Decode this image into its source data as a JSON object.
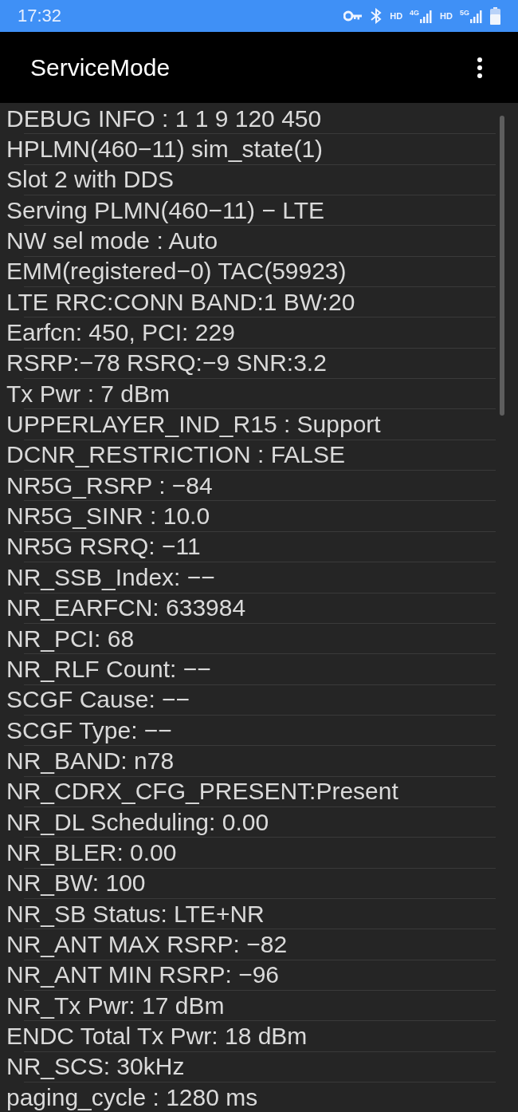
{
  "status_bar": {
    "time": "17:32",
    "indicators": [
      {
        "kind": "key"
      },
      {
        "kind": "bluetooth"
      },
      {
        "kind": "hd",
        "label": "HD"
      },
      {
        "kind": "signal",
        "label": "4G"
      },
      {
        "kind": "hd",
        "label": "HD"
      },
      {
        "kind": "signal",
        "label": "5G"
      },
      {
        "kind": "battery"
      }
    ]
  },
  "app_bar": {
    "title": "ServiceMode"
  },
  "rows": [
    "DEBUG INFO : 1 1 9 120 450",
    "HPLMN(460−11) sim_state(1)",
    "Slot 2 with DDS",
    "Serving PLMN(460−11) − LTE",
    "NW sel mode : Auto",
    "EMM(registered−0) TAC(59923)",
    "LTE RRC:CONN BAND:1 BW:20",
    "Earfcn: 450, PCI: 229",
    "RSRP:−78 RSRQ:−9 SNR:3.2",
    "Tx Pwr : 7 dBm",
    "UPPERLAYER_IND_R15 : Support",
    "DCNR_RESTRICTION : FALSE",
    "NR5G_RSRP : −84",
    "NR5G_SINR : 10.0",
    "NR5G RSRQ: −11",
    "NR_SSB_Index: −−",
    "NR_EARFCN: 633984",
    "NR_PCI: 68",
    "NR_RLF Count: −−",
    "SCGF Cause: −−",
    "SCGF Type: −−",
    "NR_BAND: n78",
    "NR_CDRX_CFG_PRESENT:Present",
    "NR_DL Scheduling: 0.00",
    "NR_BLER: 0.00",
    "NR_BW: 100",
    "NR_SB Status: LTE+NR",
    "NR_ANT MAX RSRP: −82",
    "NR_ANT MIN RSRP: −96",
    "NR_Tx Pwr: 17 dBm",
    "ENDC Total Tx Pwr: 18 dBm",
    "NR_SCS: 30kHz",
    "paging_cycle : 1280 ms"
  ]
}
